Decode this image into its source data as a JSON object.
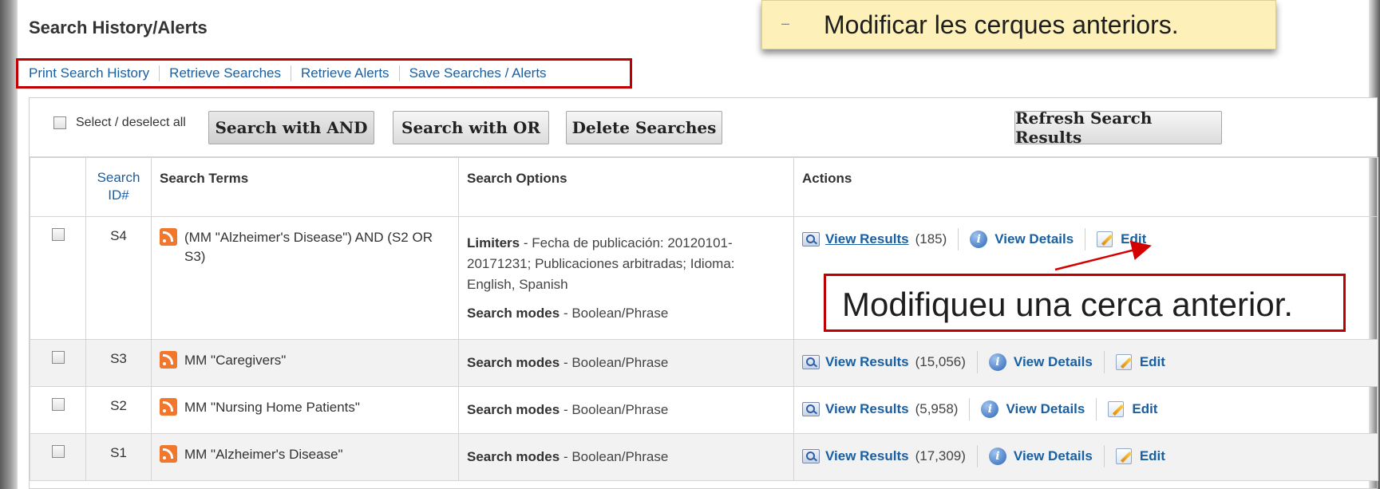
{
  "page": {
    "title": "Search History/Alerts"
  },
  "links": [
    "Print Search History",
    "Retrieve Searches",
    "Retrieve Alerts",
    "Save Searches / Alerts"
  ],
  "toolbar": {
    "select_all": "Select / deselect all",
    "search_and": "Search with AND",
    "search_or": "Search with OR",
    "delete": "Delete Searches",
    "refresh": "Refresh Search Results"
  },
  "table": {
    "headers": {
      "id_line1": "Search",
      "id_line2": "ID#",
      "terms": "Search Terms",
      "options": "Search Options",
      "actions": "Actions"
    },
    "rows": [
      {
        "id": "S4",
        "terms": "(MM \"Alzheimer's Disease\") AND (S2 OR S3)",
        "limiters_label": "Limiters",
        "limiters_text": " - Fecha de publicación: 20120101-20171231; Publicaciones arbitradas; Idioma: English, Spanish",
        "mode_label": "Search modes",
        "mode_text": " - Boolean/Phrase",
        "view_results": "View Results",
        "count": "(185)",
        "view_details": "View Details",
        "edit": "Edit"
      },
      {
        "id": "S3",
        "terms": "MM \"Caregivers\"",
        "mode_label": "Search modes",
        "mode_text": " - Boolean/Phrase",
        "view_results": "View Results",
        "count": "(15,056)",
        "view_details": "View Details",
        "edit": "Edit"
      },
      {
        "id": "S2",
        "terms": "MM \"Nursing Home Patients\"",
        "mode_label": "Search modes",
        "mode_text": " - Boolean/Phrase",
        "view_results": "View Results",
        "count": "(5,958)",
        "view_details": "View Details",
        "edit": "Edit"
      },
      {
        "id": "S1",
        "terms": "MM \"Alzheimer's Disease\"",
        "mode_label": "Search modes",
        "mode_text": " - Boolean/Phrase",
        "view_results": "View Results",
        "count": "(17,309)",
        "view_details": "View Details",
        "edit": "Edit"
      }
    ]
  },
  "annotations": {
    "top_dash": "–",
    "top": "Modificar les cerques anteriors.",
    "box": "Modifiqueu una cerca anterior."
  },
  "colors": {
    "link": "#1a5fa0",
    "highlight_border": "#c00000",
    "callout_bg": "#fdf1b9",
    "rss": "#f0772b"
  },
  "icons": [
    "rss-icon",
    "magnifier-icon",
    "info-icon",
    "edit-icon",
    "checkbox"
  ]
}
